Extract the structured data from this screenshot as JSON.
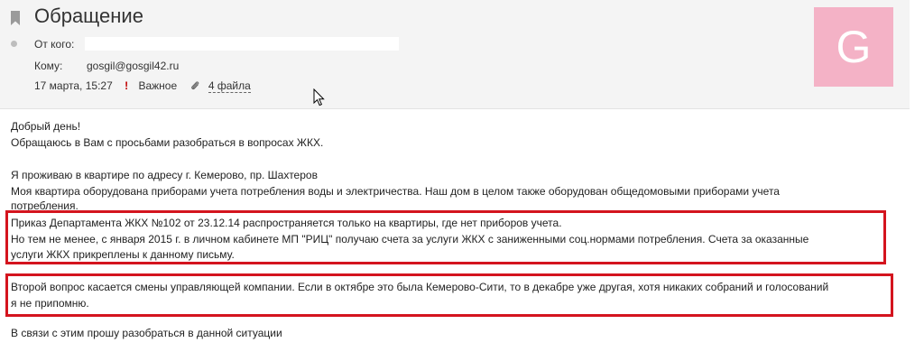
{
  "message": {
    "title": "Обращение",
    "from_label": "От кого:",
    "from_value": "",
    "to_label": "Кому:",
    "to_value": "gosgil@gosgil42.ru",
    "date": "17 марта, 15:27",
    "important_mark": "!",
    "important_label": "Важное",
    "attachments_label": "4 файла",
    "avatar_letter": "G",
    "avatar_color": "#f4b2c6"
  },
  "body": {
    "greeting": "Добрый день!",
    "intro": "Обращаюсь в Вам с просьбами разобраться в вопросах ЖКХ.",
    "address": "Я проживаю в квартире по адресу г. Кемерово, пр. Шахтеров",
    "meters_line1": "Моя квартира оборудована приборами учета потребления воды и электричества. Наш дом в целом также оборудован общедомовыми приборами учета",
    "meters_line2": "потребления.",
    "p1_line1": "Приказ Департамента ЖКХ №102 от 23.12.14 распространяется только на квартиры, где нет приборов учета.",
    "p1_line2": "Но тем не менее, с января 2015 г. в личном кабинете МП \"РИЦ\" получаю счета за услуги ЖКХ с заниженными соц.нормами потребления. Счета за оказанные",
    "p1_line3": "услуги ЖКХ прикреплены к данному письму.",
    "p2_line1": "Второй вопрос касается смены управляющей компании. Если в октябре это была Кемерово-Сити, то в декабре уже другая, хотя никаких собраний и голосований",
    "p2_line2": "я не припомню.",
    "closing": "В связи с этим прошу разобраться в данной ситуации"
  },
  "colors": {
    "highlight_border": "#d4141e",
    "important": "#c00000"
  }
}
